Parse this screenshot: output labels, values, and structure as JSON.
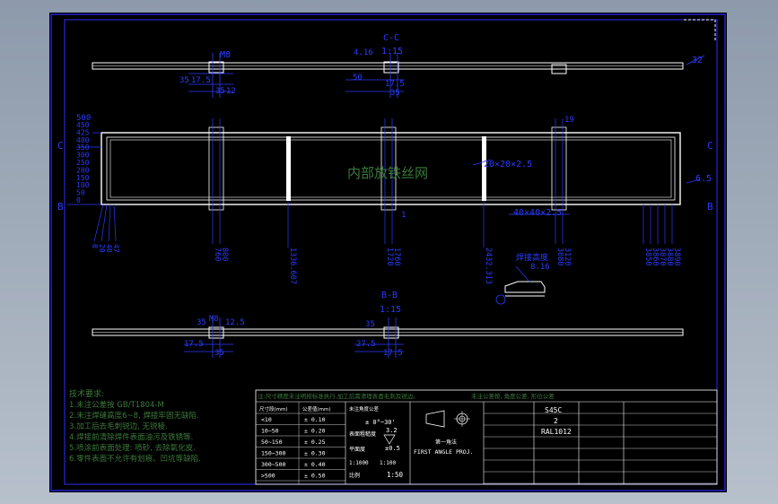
{
  "colors": {
    "border": "#2c2cff",
    "dim": "#2a3cff",
    "steel": "#ffffff",
    "note": "#3c7a3c",
    "table": "#ffffff",
    "background": "#000000"
  },
  "views": {
    "top": {
      "section_label": "C-C",
      "scale": "1:15",
      "dim_m8": "M8",
      "dim_left_a": "35",
      "dim_left_b": "17.5",
      "dim_left_c": "35",
      "dim_left_d": "12",
      "dim_mid_a": "4.16",
      "dim_mid_b": "50",
      "dim_mid_c": "17.5",
      "dim_mid_d": "35",
      "dim_right": "32"
    },
    "front": {
      "fill_note": "内部放铁丝网",
      "tube_a": "20×20×2.5",
      "tube_b": "40×40×2.5",
      "dim_top_left": "500",
      "dim_stack": [
        "450",
        "425",
        "400",
        "350",
        "300",
        "250",
        "200",
        "150",
        "100",
        "50",
        "0"
      ],
      "dim_right_a": "19",
      "dim_right_b": "6.5",
      "dim_right_c": "1",
      "cut_c_left": "C",
      "cut_c_right": "C",
      "cut_b_left": "B",
      "cut_b_right": "B",
      "bottom_dims": [
        "760",
        "800",
        "1336.607",
        "1720",
        "1760",
        "2432.313",
        "3080",
        "3120",
        "3850",
        "3860",
        "3870",
        "3880",
        "3890"
      ],
      "left_bottom_dims": [
        "0",
        "20",
        "40",
        "47"
      ],
      "detail_note": "焊接高度",
      "detail_value": "8.16"
    },
    "bottom": {
      "section_label": "B-B",
      "scale": "1:15",
      "dim_m8": "M8",
      "dim_a": "35",
      "dim_b": "12.5",
      "dim_c": "17.5",
      "dim_d": "35",
      "dim_e": "27.5",
      "dim_f": "17.5",
      "dim_g": "35"
    }
  },
  "notes": {
    "title": "技术要求:",
    "lines": [
      "1.未注公差按 GB/T1804-M",
      "2.未注焊缝高度6~8, 焊接牢固无缺陷.",
      "3.加工后去毛刺锐边, 无锐棱.",
      "4.焊接前清除焊件表面油污及铁锈等.",
      "5.喷涂前表面处理: 喷砂, 去除氧化皮.",
      "6.零件表面不允许有划痕、凹坑等缺陷."
    ]
  },
  "title_block": {
    "header_note": "注:尺寸精度未注明按标准执行,加工后需清理表面毛刺及锐边。",
    "header_right": "未注公差按, 角度公差, 形位公差",
    "tolerance_headers": [
      "尺寸段(mm)",
      "公差值(mm)"
    ],
    "tolerance_rows": [
      [
        "<10",
        "± 0.10"
      ],
      [
        "10~50",
        "± 0.20"
      ],
      [
        "50~150",
        "± 0.25"
      ],
      [
        "150~300",
        "± 0.30"
      ],
      [
        "300~500",
        "± 0.40"
      ],
      [
        ">500",
        "± 0.50"
      ]
    ],
    "angle_label": "未注角度公差",
    "angle_value": "± 0°~30'",
    "roughness_value": "3.2",
    "roughness_label": "表面粗糙度",
    "flatness_label": "平面度",
    "flatness_value": "±0.5",
    "projection_label": "FIRST ANGLE PROJ.",
    "projection_cn": "第一角法",
    "scale_label": "比例",
    "scale_value": "1:50",
    "material": "S45C",
    "quantity": "2",
    "finish": "RAL1012",
    "sheet_numbers": [
      "1:1000",
      "1:100"
    ]
  }
}
